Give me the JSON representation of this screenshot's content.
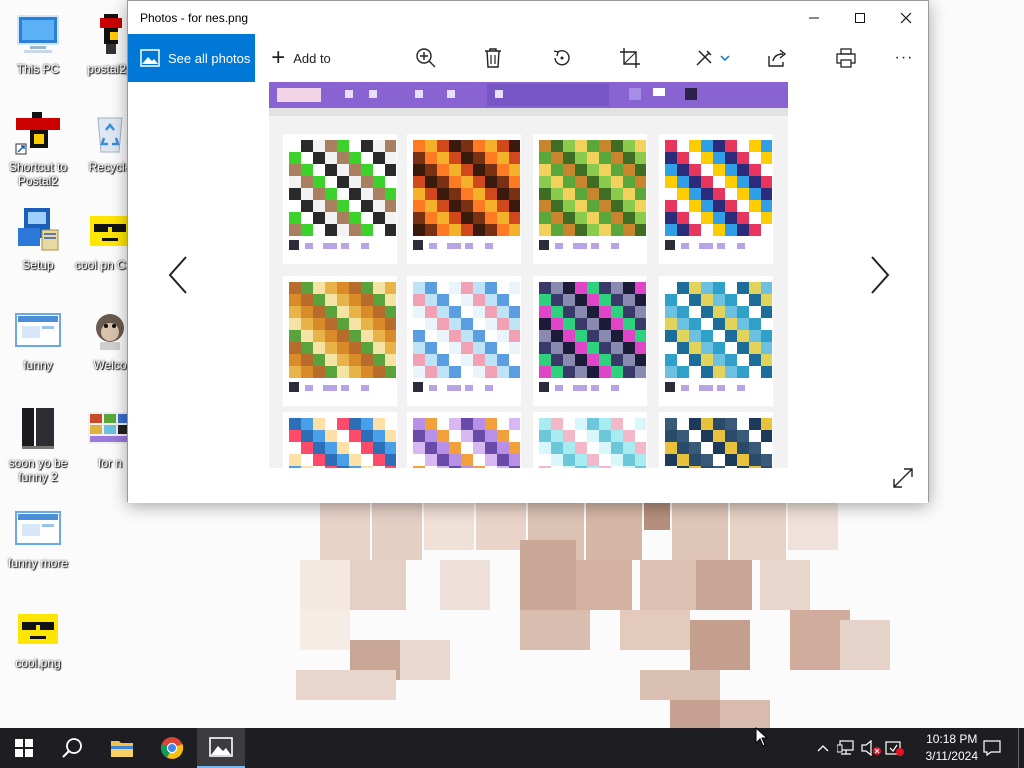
{
  "desktop": {
    "icons": [
      {
        "label": "This PC"
      },
      {
        "label": "postal2p"
      },
      {
        "label": "Shortcut to Postal2"
      },
      {
        "label": "Recycle"
      },
      {
        "label": "Setup"
      },
      {
        "label": "cool pn Copy"
      },
      {
        "label": "funny"
      },
      {
        "label": "Welco"
      },
      {
        "label": "soon yo be funny 2"
      },
      {
        "label": "for n"
      },
      {
        "label": "funny more"
      },
      {
        "label": "cool.png"
      }
    ]
  },
  "window": {
    "title": "Photos - for nes.png",
    "controls": {
      "minimize": "—",
      "maximize": "☐",
      "close": "✕"
    },
    "toolbar": {
      "see_all_label": "See all photos",
      "add_to_label": "Add to",
      "more_label": "···"
    }
  },
  "taskbar": {
    "clock": {
      "time": "10:18 PM",
      "date": "3/11/2024"
    }
  },
  "colors": {
    "accent": "#0078d7",
    "taskbar": "#1e1e22",
    "preview_bar": "#8a63d2"
  }
}
